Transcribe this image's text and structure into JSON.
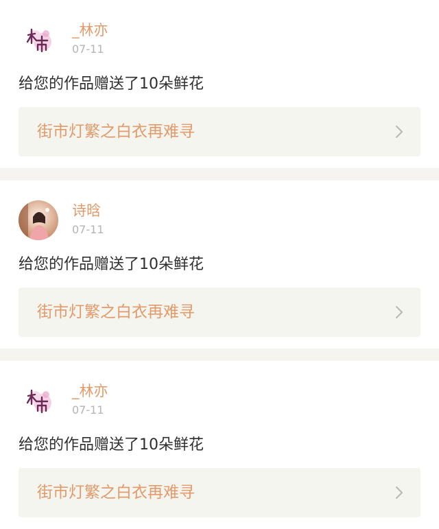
{
  "feed": {
    "items": [
      {
        "user_name": "_林亦",
        "date": "07-11",
        "message": "给您的作品赠送了10朵鲜花",
        "work_title": "街市灯繁之白衣再难寻",
        "avatar_type": "logo"
      },
      {
        "user_name": "诗晗",
        "date": "07-11",
        "message": "给您的作品赠送了10朵鲜花",
        "work_title": "街市灯繁之白衣再难寻",
        "avatar_type": "photo"
      },
      {
        "user_name": "_林亦",
        "date": "07-11",
        "message": "给您的作品赠送了10朵鲜花",
        "work_title": "街市灯繁之白衣再难寻",
        "avatar_type": "logo"
      }
    ]
  },
  "colors": {
    "accent": "#e39a6b",
    "text": "#2f2f2f",
    "muted": "#b4b4b4",
    "card_bg": "#f5f5ef",
    "divider": "#f5f4f1"
  },
  "icons": {
    "chevron": "chevron-right-icon",
    "logo_avatar": "lin-yi-logo-avatar",
    "photo_avatar": "portrait-photo-avatar"
  }
}
